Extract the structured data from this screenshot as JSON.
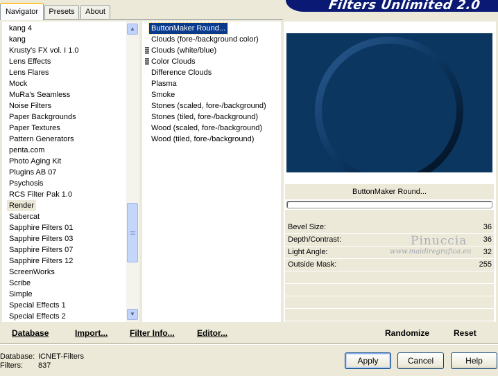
{
  "tabs": [
    "Navigator",
    "Presets",
    "About"
  ],
  "banner_title": "Filters Unlimited 2.0",
  "categories": [
    "kang 4",
    "kang",
    "Krusty's FX vol. I 1.0",
    "Lens Effects",
    "Lens Flares",
    "Mock",
    "MuRa's Seamless",
    "Noise Filters",
    "Paper Backgrounds",
    "Paper Textures",
    "Pattern Generators",
    "penta.com",
    "Photo Aging Kit",
    "Plugins AB 07",
    "Psychosis",
    "RCS Filter Pak 1.0",
    "Render",
    "Sabercat",
    "Sapphire Filters 01",
    "Sapphire Filters 03",
    "Sapphire Filters 07",
    "Sapphire Filters 12",
    "ScreenWorks",
    "Scribe",
    "Simple",
    "Special Effects 1",
    "Special Effects 2"
  ],
  "selected_category": "Render",
  "filters": [
    "ButtonMaker Round...",
    "Clouds (fore-/background color)",
    "Clouds (white/blue)",
    "Color Clouds",
    "Difference Clouds",
    "Plasma",
    "Smoke",
    "Stones (scaled, fore-/background)",
    "Stones (tiled, fore-/background)",
    "Wood (scaled, fore-/background)",
    "Wood (tiled, fore-/background)"
  ],
  "selected_filter": "ButtonMaker Round...",
  "filter_name": "ButtonMaker Round...",
  "params": [
    {
      "label": "Bevel Size:",
      "value": "36"
    },
    {
      "label": "Depth/Contrast:",
      "value": "36"
    },
    {
      "label": "Light Angle:",
      "value": "32"
    },
    {
      "label": "Outside Mask:",
      "value": "255"
    }
  ],
  "watermark": {
    "line1": "Pinuccia",
    "line2": "www.maidiregrafica.eu"
  },
  "toolbar": {
    "database": "Database",
    "import": "Import...",
    "filter_info": "Filter Info...",
    "editor": "Editor...",
    "randomize": "Randomize",
    "reset": "Reset"
  },
  "info": {
    "database_label": "Database:",
    "database_value": "ICNET-Filters",
    "filters_label": "Filters:",
    "filters_value": "837"
  },
  "buttons": {
    "apply": "Apply",
    "cancel": "Cancel",
    "help": "Help"
  },
  "colors": {
    "preview_bg": "#0b3660",
    "selection": "#0a3a8c",
    "banner": "#0a1a74"
  }
}
